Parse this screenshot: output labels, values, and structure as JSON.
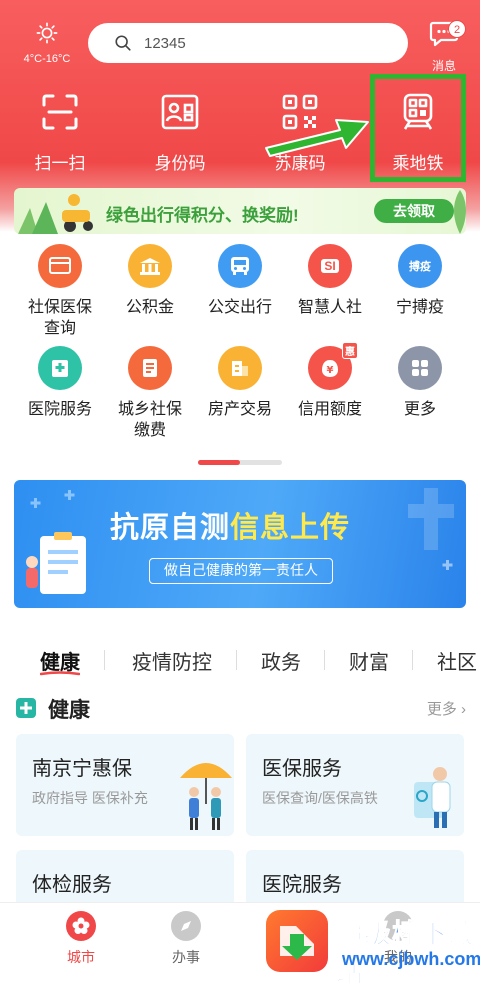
{
  "header": {
    "weather_temp": "4°C-16°C",
    "search_value": "12345",
    "messages_label": "消息",
    "messages_badge": "2"
  },
  "quick_actions": [
    {
      "label": "扫一扫",
      "icon": "scan-icon"
    },
    {
      "label": "身份码",
      "icon": "id-card-icon"
    },
    {
      "label": "苏康码",
      "icon": "qr-code-icon"
    },
    {
      "label": "乘地铁",
      "icon": "metro-qr-icon"
    }
  ],
  "promo_banner": {
    "text": "绿色出行得积分、换奖励!",
    "button": "去领取"
  },
  "services": [
    {
      "label": "社保医保\n查询",
      "color": "#f46a3c",
      "icon": "social-insurance-icon"
    },
    {
      "label": "公积金",
      "color": "#f9b233",
      "icon": "housing-fund-icon"
    },
    {
      "label": "公交出行",
      "color": "#3f9cf2",
      "icon": "bus-icon"
    },
    {
      "label": "智慧人社",
      "color": "#f4544a",
      "icon": "smart-hr-icon",
      "badge_text": "SI"
    },
    {
      "label": "宁搏疫",
      "color": "#3c95ef",
      "icon": "epidemic-icon",
      "badge_text": "搏疫"
    },
    {
      "label": "医院服务",
      "color": "#2ec2a6",
      "icon": "hospital-icon"
    },
    {
      "label": "城乡社保\n缴费",
      "color": "#f46a3c",
      "icon": "payment-icon"
    },
    {
      "label": "房产交易",
      "color": "#f9b233",
      "icon": "house-icon"
    },
    {
      "label": "信用额度",
      "color": "#f4544a",
      "icon": "credit-icon",
      "badge_text": "惠"
    },
    {
      "label": "更多",
      "color": "#8d96a8",
      "icon": "more-grid-icon"
    }
  ],
  "main_banner": {
    "title_part1": "抗原自测",
    "title_part2": "信息上传",
    "subtitle": "做自己健康的第一责任人"
  },
  "tabs": [
    "健康",
    "疫情防控",
    "政务",
    "财富",
    "社区"
  ],
  "section": {
    "title": "健康",
    "more": "更多"
  },
  "cards": [
    {
      "title": "南京宁惠保",
      "subtitle": "政府指导 医保补充"
    },
    {
      "title": "医保服务",
      "subtitle": "医保查询/医保高铁"
    },
    {
      "title": "体检服务",
      "subtitle": ""
    },
    {
      "title": "医院服务",
      "subtitle": ""
    }
  ],
  "bottom_nav": [
    {
      "label": "城市",
      "active": true
    },
    {
      "label": "办事",
      "active": false
    },
    {
      "label": "我的",
      "active": false
    }
  ],
  "watermark": {
    "title": "超级棒下载站",
    "url": "www.cjbwh.com"
  },
  "colors": {
    "primary_red": "#f04848",
    "highlight_green": "#2fb52f",
    "banner_blue": "#2e8ff1"
  }
}
